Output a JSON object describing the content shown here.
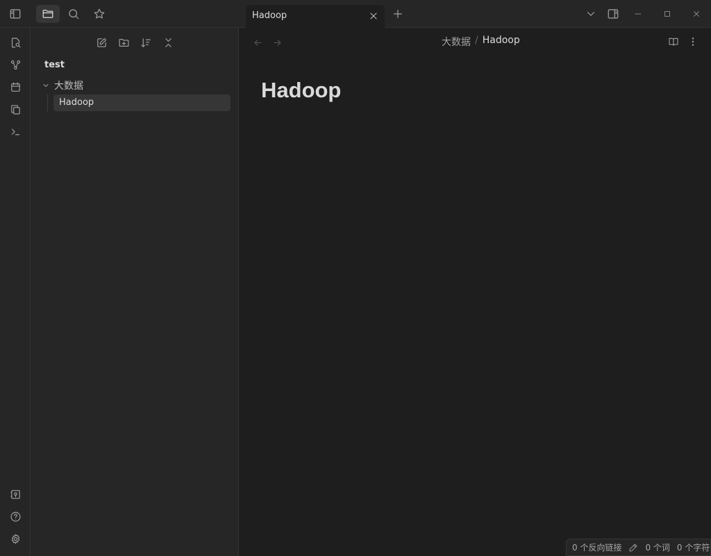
{
  "tabs": [
    {
      "title": "Hadoop",
      "active": true
    }
  ],
  "sidebar": {
    "vault_name": "test",
    "tree": {
      "folder": "大数据",
      "files": [
        "Hadoop"
      ]
    }
  },
  "editor": {
    "breadcrumb": {
      "folder": "大数据",
      "separator": "/",
      "file": "Hadoop"
    },
    "title": "Hadoop"
  },
  "statusbar": {
    "backlinks": "0 个反向链接",
    "words": "0 个词",
    "chars": "0 个字符"
  },
  "icons": {
    "ribbon": [
      "file-search-icon",
      "graph-icon",
      "calendar-icon",
      "copy-icon",
      "terminal-icon",
      "vault-icon",
      "help-icon",
      "settings-icon"
    ]
  },
  "colors": {
    "background": "#1e1e1e",
    "panel": "#262626",
    "selected": "#363636",
    "text": "#dcddde",
    "muted": "#a3a3a3"
  }
}
